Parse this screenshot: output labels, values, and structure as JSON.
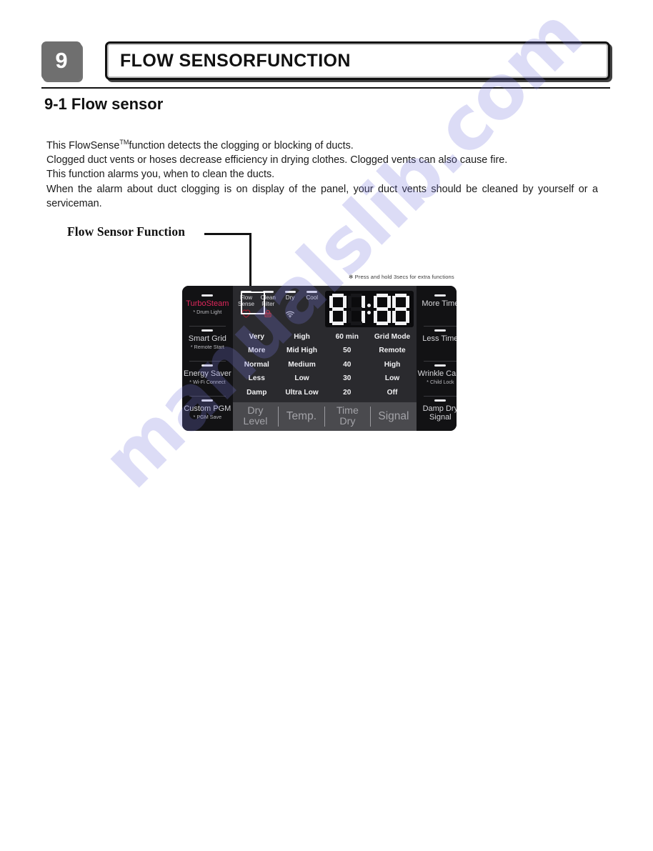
{
  "header": {
    "chapter_number": "9",
    "chapter_title": "FLOW SENSORFUNCTION"
  },
  "section": {
    "heading": "9-1 Flow sensor"
  },
  "body": {
    "line1_a": "This FlowSense",
    "line1_tm": "TM",
    "line1_b": "function detects the clogging or blocking of ducts.",
    "line2": "Clogged duct vents or hoses decrease efficiency in drying clothes. Clogged vents can also cause fire.",
    "line3": "This function alarms you, when to clean the ducts.",
    "line4": "When the alarm about duct clogging is on display of the panel, your duct vents should be cleaned by yourself or a serviceman."
  },
  "callout": {
    "label": "Flow Sensor Function"
  },
  "control_panel": {
    "note": "✻ Press and hold 3secs for extra functions",
    "left_buttons": [
      {
        "label": "TurboSteam",
        "sub": "* Drum Light",
        "accent": "#e0275c"
      },
      {
        "label": "Smart Grid",
        "sub": "* Remote Start",
        "accent": "#d6d6da"
      },
      {
        "label": "Energy Saver",
        "sub": "* Wi-Fi Connect",
        "accent": "#d6d6da"
      },
      {
        "label": "Custom PGM",
        "sub": "* PGM Save",
        "accent": "#d6d6da"
      }
    ],
    "status_buttons": [
      {
        "label": "Flow Sense",
        "icon": "heart-icon"
      },
      {
        "label": "Clean Filter",
        "icon": "lock-icon"
      },
      {
        "label": "Dry",
        "icon": "wifi-icon"
      },
      {
        "label": "Cool",
        "icon": "none"
      }
    ],
    "display": {
      "digits": [
        "8",
        "1",
        ":",
        "8",
        "8"
      ],
      "value": "81:88"
    },
    "option_columns": [
      {
        "name": "Dry Level",
        "items": [
          "Very",
          "More",
          "Normal",
          "Less",
          "Damp"
        ]
      },
      {
        "name": "Temp.",
        "items": [
          "High",
          "Mid High",
          "Medium",
          "Low",
          "Ultra Low"
        ]
      },
      {
        "name": "Time Dry",
        "items": [
          "60 min",
          "50",
          "40",
          "30",
          "20"
        ]
      },
      {
        "name": "Signal",
        "items": [
          "Grid Mode",
          "Remote",
          "High",
          "Low",
          "Off"
        ]
      }
    ],
    "footer_labels": [
      {
        "l1": "Dry",
        "l2": "Level"
      },
      {
        "l1": "Temp.",
        "l2": ""
      },
      {
        "l1": "Time",
        "l2": "Dry"
      },
      {
        "l1": "Signal",
        "l2": ""
      }
    ],
    "right_buttons": [
      {
        "label": "More Time",
        "sub": ""
      },
      {
        "label": "Less Time",
        "sub": ""
      },
      {
        "label": "Wrinkle Care",
        "sub": "* Child Lock"
      },
      {
        "label": "Damp Dry",
        "sub": "Signal"
      }
    ]
  },
  "watermark": {
    "text": "manualslib.com"
  }
}
